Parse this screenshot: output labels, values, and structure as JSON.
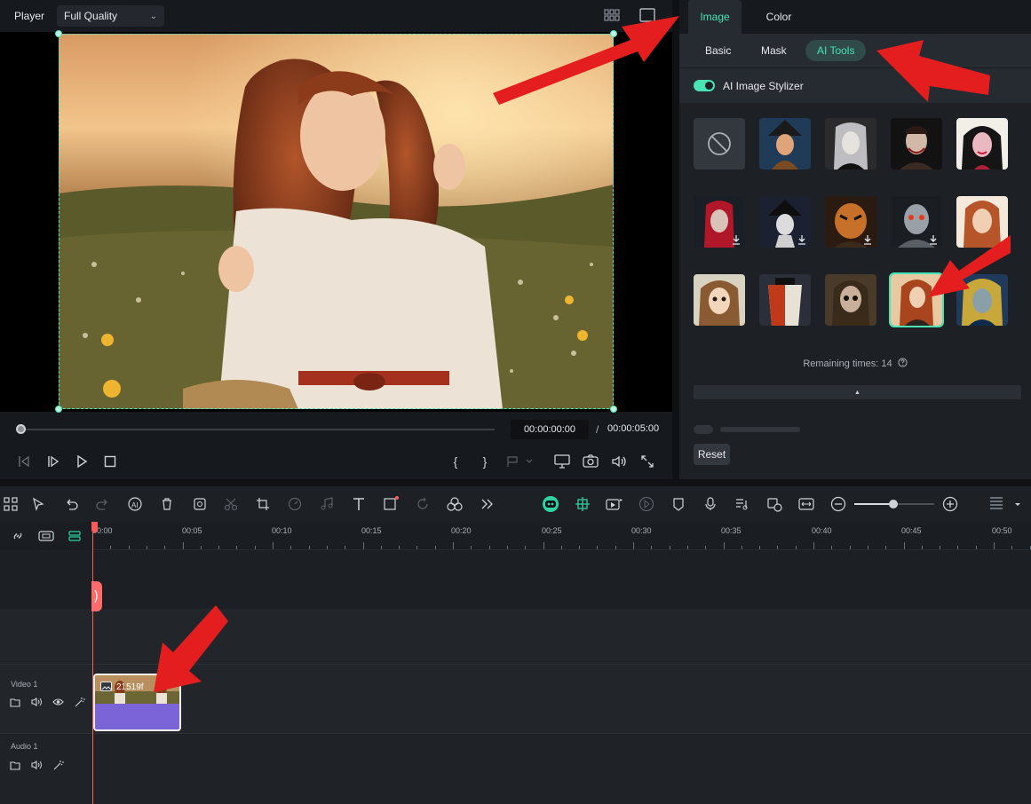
{
  "player": {
    "label": "Player",
    "quality": "Full Quality",
    "timecode_current": "00:00:00:00",
    "timecode_separator": "/",
    "timecode_total": "00:00:05:00"
  },
  "panel": {
    "tabs": [
      {
        "label": "Image"
      },
      {
        "label": "Color"
      }
    ],
    "subtabs": [
      {
        "label": "Basic"
      },
      {
        "label": "Mask"
      },
      {
        "label": "AI Tools"
      }
    ],
    "stylizer_label": "AI Image Stylizer",
    "stylizer_enabled": true,
    "remaining": "Remaining times: 14",
    "reset_label": "Reset"
  },
  "timeline": {
    "ruler_labels": [
      "00:00",
      "00:05",
      "00:10",
      "00:15",
      "00:20",
      "00:25",
      "00:30",
      "00:35",
      "00:40",
      "00:45",
      "00:50"
    ],
    "video_track_label": "Video 1",
    "audio_track_label": "Audio 1",
    "clip_name": "21519f"
  },
  "colors": {
    "accent": "#49e3b4",
    "playhead": "#ff5a5a",
    "clip": "#7a64d8",
    "annotation_arrow": "#e41e1e"
  }
}
